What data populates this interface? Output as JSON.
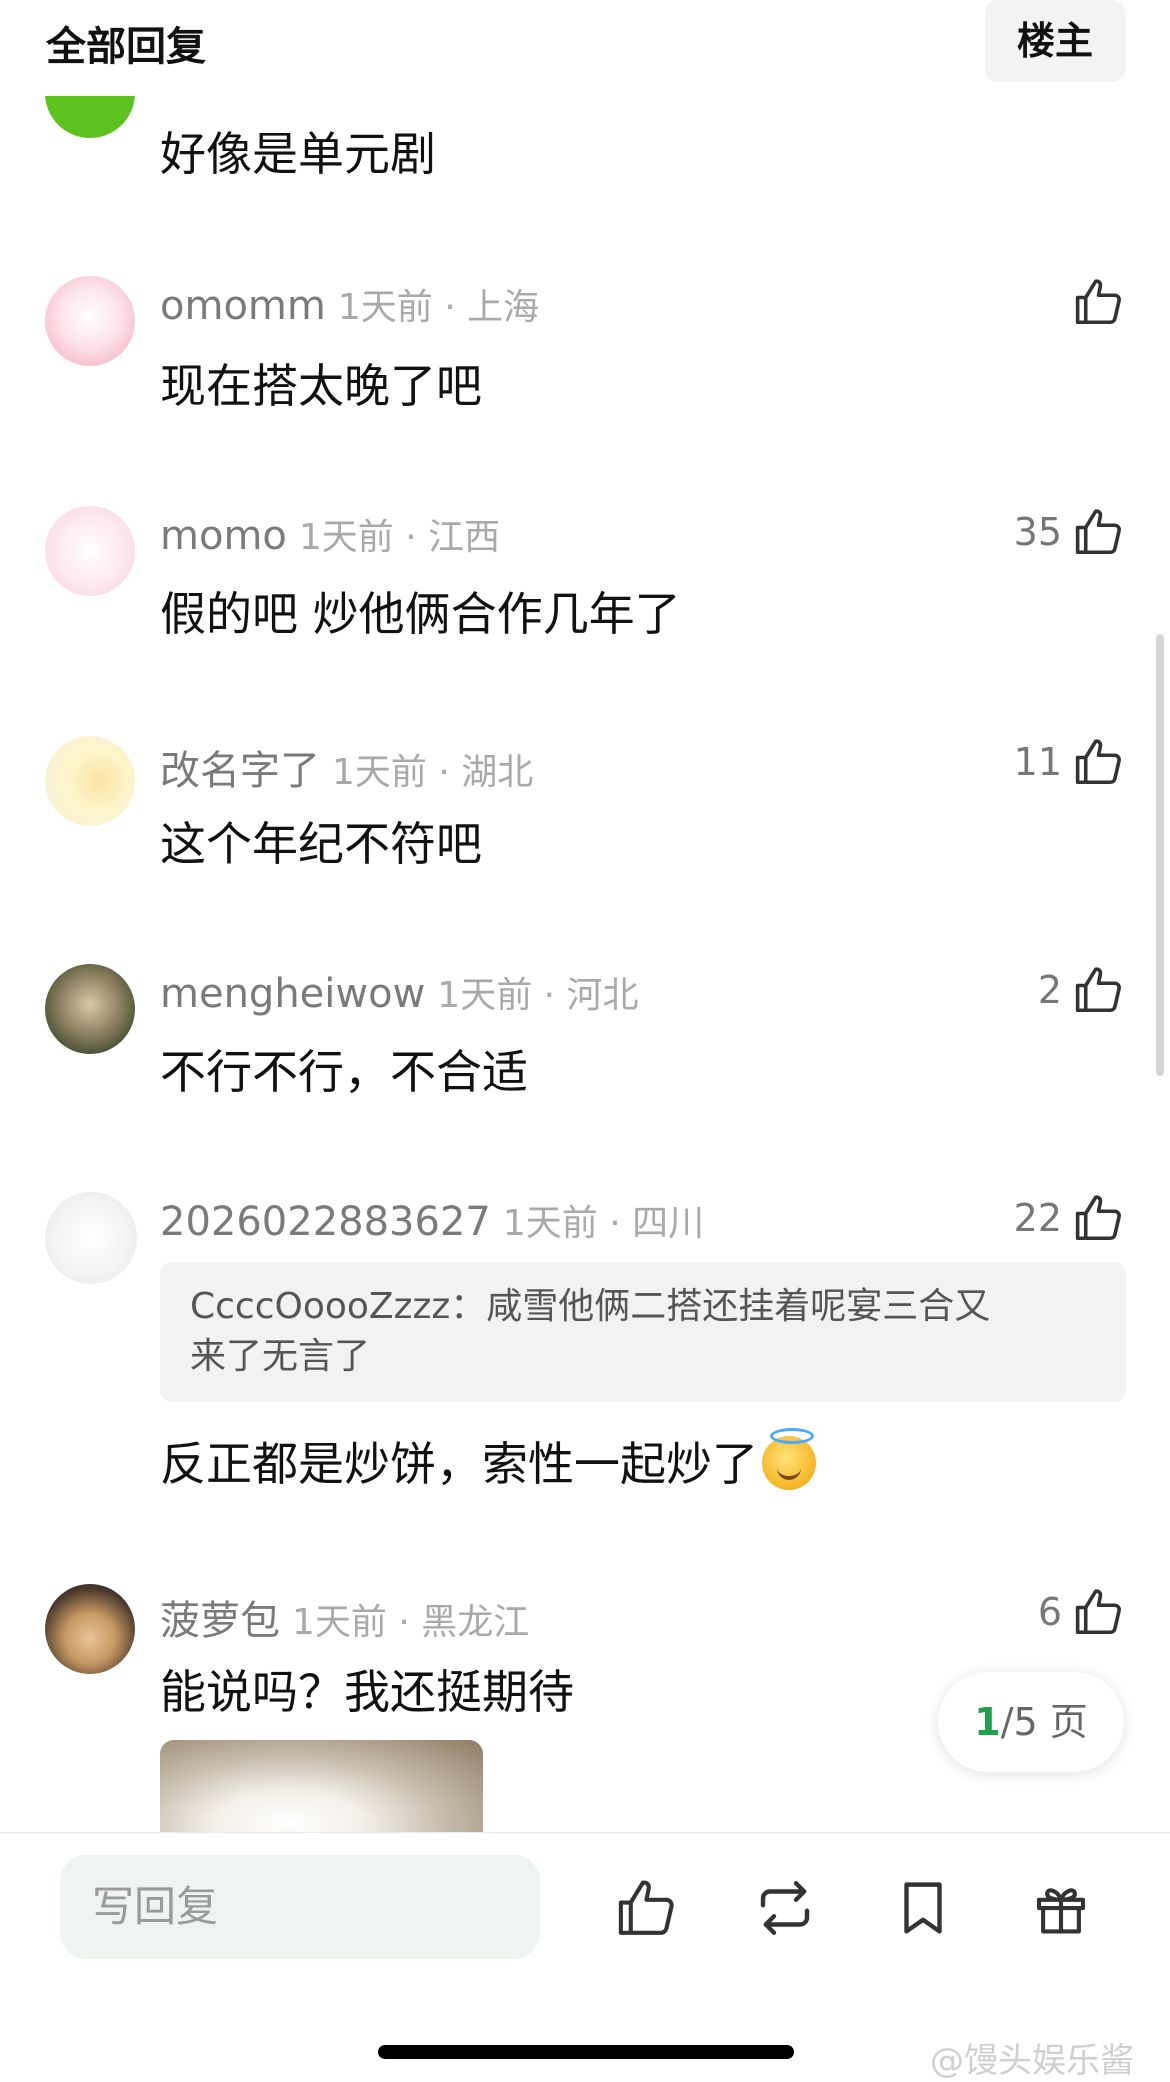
{
  "header": {
    "title": "全部回复",
    "op_label": "楼主"
  },
  "comments": [
    {
      "text": "好像是单元剧"
    },
    {
      "name": "omomm",
      "time_loc": "1天前 · 上海",
      "likes": "",
      "text": "现在搭太晚了吧"
    },
    {
      "name": "momo",
      "time_loc": "1天前 · 江西",
      "likes": "35",
      "text": "假的吧  炒他俩合作几年了"
    },
    {
      "name": "改名字了",
      "time_loc": "1天前 · 湖北",
      "likes": "11",
      "text": "这个年纪不符吧"
    },
    {
      "name": "mengheiwow",
      "time_loc": "1天前 · 河北",
      "likes": "2",
      "text": "不行不行，不合适"
    },
    {
      "name": "2026022883627",
      "time_loc": "1天前 · 四川",
      "likes": "22",
      "quote_line1": "CcccOoooZzzz：咸雪他俩二搭还挂着呢宴三合又",
      "quote_line2": "来了无言了",
      "text": "反正都是炒饼，索性一起炒了"
    },
    {
      "name": "菠萝包",
      "time_loc": "1天前 · 黑龙江",
      "likes": "6",
      "text": "能说吗？我还挺期待"
    }
  ],
  "pager": {
    "current": "1",
    "rest": "/5 页"
  },
  "bottom_bar": {
    "reply_placeholder": "写回复"
  },
  "icons": {
    "like": "thumbs-up-icon",
    "repost": "repost-icon",
    "bookmark": "bookmark-icon",
    "gift": "gift-icon"
  },
  "watermark": "@馒头娱乐酱",
  "colors": {
    "accent_green": "#1aa34a",
    "reply_box_bg": "#eef4ef"
  }
}
